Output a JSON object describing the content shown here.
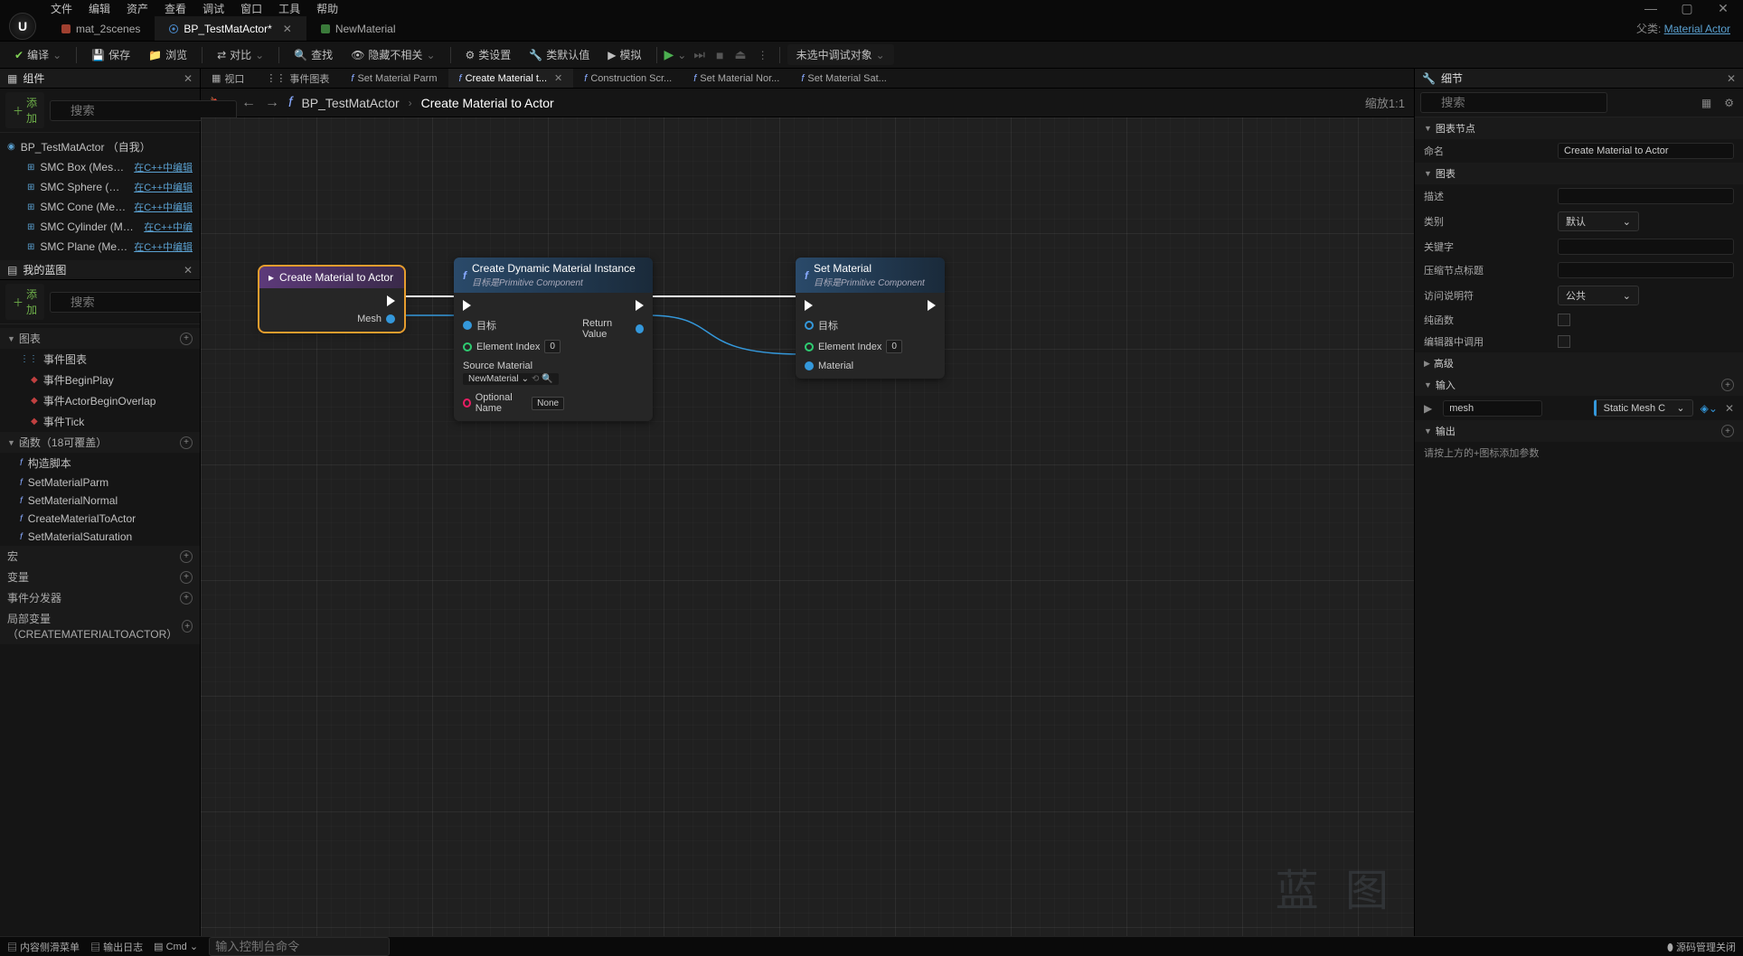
{
  "menu": {
    "items": [
      "文件",
      "编辑",
      "资产",
      "查看",
      "调试",
      "窗口",
      "工具",
      "帮助"
    ]
  },
  "tabs": [
    {
      "label": "mat_2scenes",
      "active": false,
      "type": "maroon"
    },
    {
      "label": "BP_TestMatActor*",
      "active": true,
      "type": "bpclass"
    },
    {
      "label": "NewMaterial",
      "active": false,
      "type": "green"
    }
  ],
  "parent": {
    "label": "父类:",
    "value": "Material Actor"
  },
  "toolbar": {
    "compile": "编译",
    "save": "保存",
    "browse": "浏览",
    "diff": "对比",
    "find": "查找",
    "hide": "隐藏不相关",
    "classSettings": "类设置",
    "classDefaults": "类默认值",
    "simulate": "模拟",
    "debugTarget": "未选中调试对象"
  },
  "panels": {
    "components": "组件",
    "myBlueprint": "我的蓝图",
    "details": "细节",
    "addLabel": "添加",
    "searchPlaceholder": "搜索"
  },
  "components": [
    {
      "label": "BP_TestMatActor （自我）",
      "indent": 0
    },
    {
      "label": "SMC Box (MeshBox)",
      "indent": 1,
      "link": "在C++中编辑"
    },
    {
      "label": "SMC Sphere (MeshSphere)",
      "indent": 1,
      "link": "在C++中编辑"
    },
    {
      "label": "SMC Cone (MeshCone)",
      "indent": 1,
      "link": "在C++中编辑"
    },
    {
      "label": "SMC Cylinder (MeshCylinder)",
      "indent": 1,
      "link": "在C++中编"
    },
    {
      "label": "SMC Plane (MeshPlane)",
      "indent": 1,
      "link": "在C++中编辑"
    }
  ],
  "mybp": {
    "graphs": "图表",
    "eventGraph": "事件图表",
    "events": [
      "事件BeginPlay",
      "事件ActorBeginOverlap",
      "事件Tick"
    ],
    "funcs": "函数（18可覆盖）",
    "funcList": [
      "构造脚本",
      "SetMaterialParm",
      "SetMaterialNormal",
      "CreateMaterialToActor",
      "SetMaterialSaturation"
    ],
    "macros": "宏",
    "variables": "变量",
    "dispatchers": "事件分发器",
    "localVars": "局部变量（CREATEMATERIALTOACTOR）"
  },
  "centerTabs": [
    {
      "label": "视口",
      "icon": "viewport"
    },
    {
      "label": "事件图表",
      "icon": "graph"
    },
    {
      "label": "Set Material Parm",
      "icon": "fn"
    },
    {
      "label": "Create Material t...",
      "icon": "fn",
      "active": true
    },
    {
      "label": "Construction Scr...",
      "icon": "fn"
    },
    {
      "label": "Set Material Nor...",
      "icon": "fn"
    },
    {
      "label": "Set Material Sat...",
      "icon": "fn"
    }
  ],
  "breadcrumb": {
    "root": "BP_TestMatActor",
    "leaf": "Create Material to Actor",
    "zoom": "缩放1:1"
  },
  "nodes": {
    "entry": {
      "title": "Create Material to Actor",
      "pins": {
        "out": "",
        "mesh": "Mesh"
      }
    },
    "create": {
      "title": "Create Dynamic Material Instance",
      "subtitle": "目标是Primitive Component",
      "pins": {
        "target": "目标",
        "elementIndex": "Element Index",
        "elementIndexVal": "0",
        "sourceMat": "Source Material",
        "sourceMatVal": "NewMaterial",
        "optName": "Optional Name",
        "optNameVal": "None",
        "returnVal": "Return Value"
      }
    },
    "set": {
      "title": "Set Material",
      "subtitle": "目标是Primitive Component",
      "pins": {
        "target": "目标",
        "elementIndex": "Element Index",
        "elementIndexVal": "0",
        "material": "Material"
      }
    }
  },
  "watermark": "蓝 图",
  "details": {
    "sections": {
      "graphNode": "图表节点",
      "graph": "图表",
      "advanced": "高级",
      "inputs": "输入",
      "outputs": "输出"
    },
    "name": "命名",
    "nameVal": "Create Material to Actor",
    "desc": "描述",
    "category": "类别",
    "categoryVal": "默认",
    "keywords": "关键字",
    "compactTitle": "压缩节点标题",
    "access": "访问说明符",
    "accessVal": "公共",
    "pure": "纯函数",
    "editorCall": "编辑器中调用",
    "inputName": "mesh",
    "inputType": "Static Mesh C",
    "outputsHint": "请按上方的+图标添加参数"
  },
  "statusbar": {
    "drawer": "内容侧滑菜单",
    "outputLog": "输出日志",
    "cmd": "Cmd",
    "cmdPlaceholder": "输入控制台命令",
    "sourceControl": "源码管理关闭"
  }
}
